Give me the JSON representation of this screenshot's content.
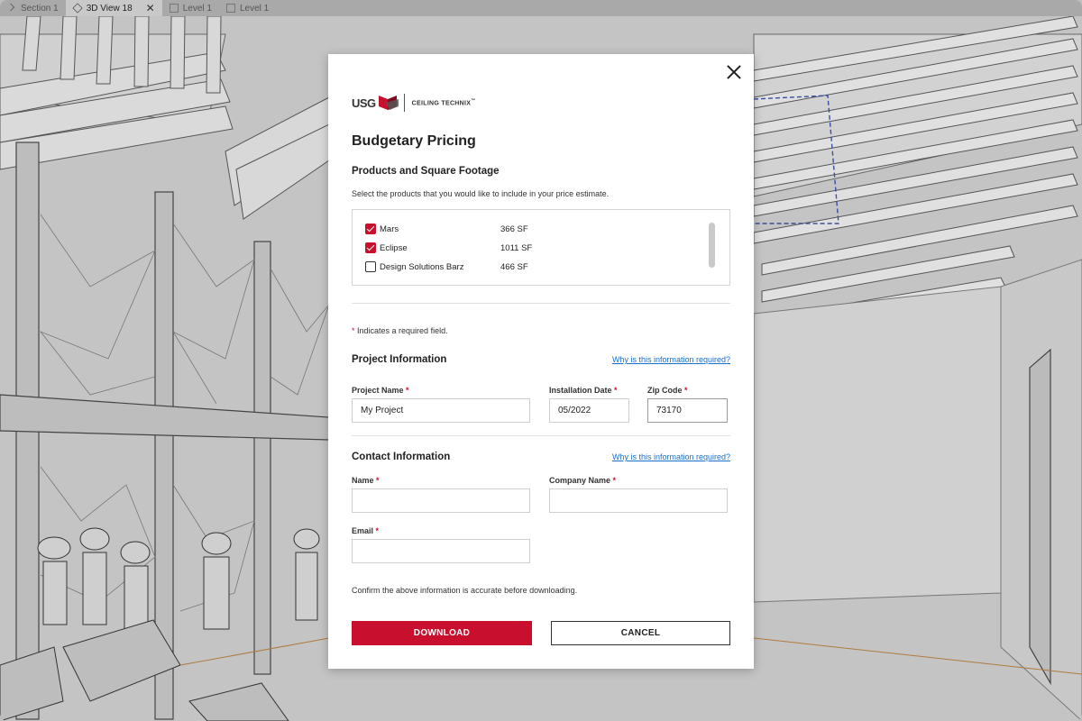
{
  "app": {
    "tabs": [
      {
        "label": "Section 1",
        "icon": "chevron-icon"
      },
      {
        "label": "3D View 18",
        "icon": "3d-view-icon",
        "active": true,
        "close": "✕"
      },
      {
        "label": "Level 1",
        "icon": "floor-plan-icon"
      },
      {
        "label": "Level 1",
        "icon": "floor-plan-icon"
      }
    ]
  },
  "modal": {
    "logo": {
      "brand": "USG",
      "product": "CEILING TECHNIX",
      "trademark": "™",
      "brand_color": "#c8102e"
    },
    "title": "Budgetary Pricing",
    "products": {
      "heading": "Products and Square Footage",
      "hint": "Select the products that you would like to include in your price estimate.",
      "items": [
        {
          "name": "Mars",
          "area": "366 SF",
          "checked": true
        },
        {
          "name": "Eclipse",
          "area": "1011 SF",
          "checked": true
        },
        {
          "name": "Design Solutions Barz",
          "area": "466 SF",
          "checked": false
        }
      ]
    },
    "required_note": {
      "asterisk": "*",
      "text": " Indicates a required field."
    },
    "project": {
      "heading": "Project Information",
      "why_link": "Why is this information required?",
      "project_name": {
        "label": "Project Name",
        "value": "My Project"
      },
      "installation_date": {
        "label": "Installation Date",
        "value": "05/2022"
      },
      "zip_code": {
        "label": "Zip Code",
        "value": "73170"
      }
    },
    "contact": {
      "heading": "Contact Information",
      "why_link": "Why is this information required?",
      "name": {
        "label": "Name",
        "value": ""
      },
      "company_name": {
        "label": "Company Name",
        "value": ""
      },
      "email": {
        "label": "Email",
        "value": ""
      }
    },
    "asterisk": "*",
    "confirm_text": "Confirm the above information is accurate before downloading.",
    "download_label": "DOWNLOAD",
    "cancel_label": "CANCEL",
    "accent_color": "#c8102e",
    "link_color": "#1a6fc9"
  }
}
